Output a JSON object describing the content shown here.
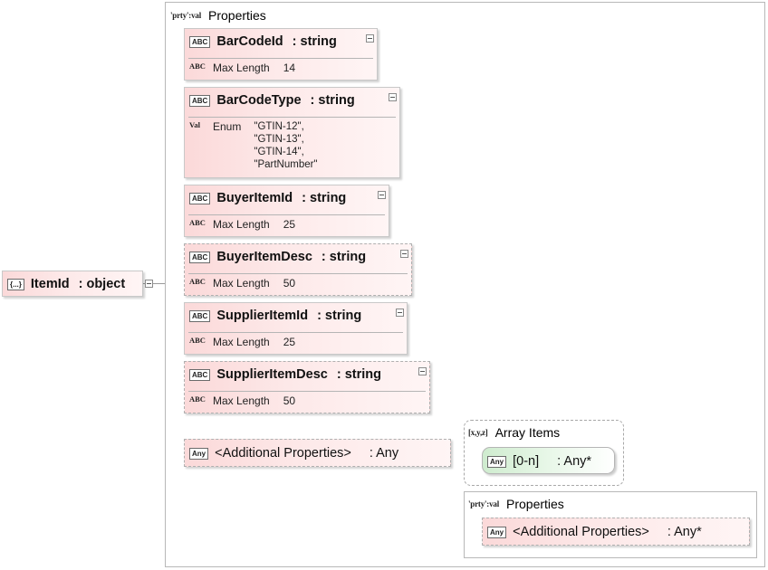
{
  "root": {
    "badge": "{...}",
    "name": "ItemId",
    "type": ": object"
  },
  "properties": {
    "tag": "'prty':val",
    "title": "Properties",
    "items": [
      {
        "badge": "ABC",
        "name": "BarCodeId",
        "type": ": string",
        "facet_badge": "ABC",
        "facet_label": "Max Length",
        "facet_value": "14"
      },
      {
        "badge": "ABC",
        "name": "BarCodeType",
        "type": ": string",
        "facet_badge": "Val",
        "facet_label": "Enum",
        "enum_values": [
          "\"GTIN-12\",",
          "\"GTIN-13\",",
          "\"GTIN-14\",",
          "\"PartNumber\""
        ]
      },
      {
        "badge": "ABC",
        "name": "BuyerItemId",
        "type": ": string",
        "facet_badge": "ABC",
        "facet_label": "Max Length",
        "facet_value": "25"
      },
      {
        "badge": "ABC",
        "name": "BuyerItemDesc",
        "type": ": string",
        "facet_badge": "ABC",
        "facet_label": "Max Length",
        "facet_value": "50"
      },
      {
        "badge": "ABC",
        "name": "SupplierItemId",
        "type": ": string",
        "facet_badge": "ABC",
        "facet_label": "Max Length",
        "facet_value": "25"
      },
      {
        "badge": "ABC",
        "name": "SupplierItemDesc",
        "type": ": string",
        "facet_badge": "ABC",
        "facet_label": "Max Length",
        "facet_value": "50"
      }
    ],
    "additional": {
      "badge": "Any",
      "name": "<Additional Properties>",
      "type": ": Any"
    }
  },
  "array_items": {
    "tag": "[x,y,z]",
    "title": "Array Items",
    "item": {
      "badge": "Any",
      "name": "[0-n]",
      "type": ": Any*"
    }
  },
  "sub_properties": {
    "tag": "'prty':val",
    "title": "Properties",
    "item": {
      "badge": "Any",
      "name": "<Additional Properties>",
      "type": ": Any*"
    }
  },
  "colors": {
    "node_fill": "#fbd9d9",
    "array_fill": "#cfeccf",
    "border": "#b8b8b8"
  }
}
